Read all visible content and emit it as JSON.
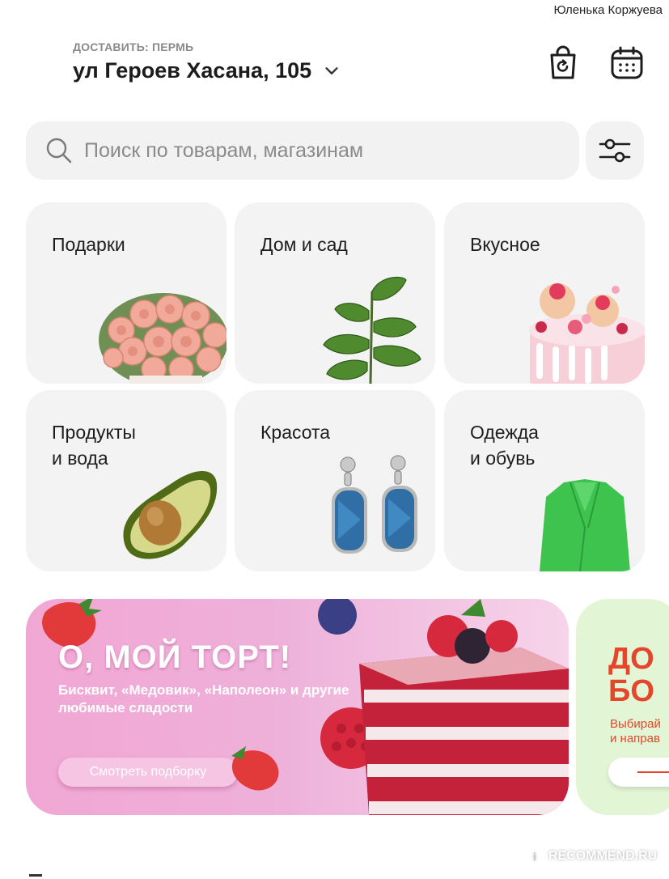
{
  "user": {
    "name": "Юленька Коржуева"
  },
  "header": {
    "delivery_label": "ДОСТАВИТЬ: ПЕРМЬ",
    "address": "ул Героев Хасана, 105",
    "icons": [
      "chevron-down-icon",
      "orders-bag-icon",
      "calendar-icon"
    ]
  },
  "search": {
    "placeholder": "Поиск по товарам, магазинам",
    "icons": [
      "search-icon",
      "filter-sliders-icon"
    ]
  },
  "categories": [
    {
      "label": "Подарки",
      "icon": "flower-bouquet-image"
    },
    {
      "label": "Дом и сад",
      "icon": "plant-image"
    },
    {
      "label": "Вкусное",
      "icon": "cake-image"
    },
    {
      "label": "Продукты\nи вода",
      "icon": "avocado-image"
    },
    {
      "label": "Красота",
      "icon": "earrings-image"
    },
    {
      "label": "Одежда\nи обувь",
      "icon": "green-jacket-image"
    }
  ],
  "banners": [
    {
      "title": "О, МОЙ ТОРТ!",
      "subtitle": "Бисквит, «Медовик», «Наполеон» и другие любимые сладости",
      "button": "Смотреть подборку"
    },
    {
      "title": "ДО\nБО",
      "subtitle": "Выбирай\nи направ"
    }
  ],
  "watermark": {
    "text": "RECOMMEND.RU",
    "badge": "i"
  },
  "colors": {
    "card_background": "#f3f3f3",
    "banner_pink": "#eeb0d9",
    "banner_green": "#e2f6d6",
    "accent_red": "#e5452a"
  }
}
